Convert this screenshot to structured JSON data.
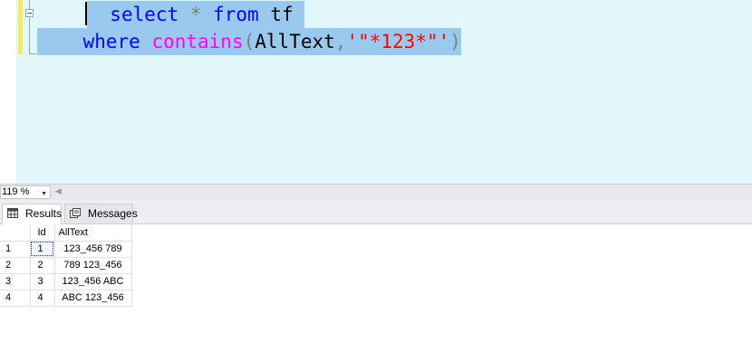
{
  "editor": {
    "line1": {
      "select": "select",
      "star": "*",
      "from": "from",
      "table": "tf"
    },
    "line2": {
      "where": "where",
      "contains": "contains",
      "open_paren": "(",
      "column": "AllText",
      "comma": ",",
      "literal": "'\"*123*\"'",
      "close_paren": ")"
    }
  },
  "zoom": {
    "value": "119 %"
  },
  "tabs": {
    "results_label": "Results",
    "messages_label": "Messages"
  },
  "grid": {
    "columns": [
      "Id",
      "AllText"
    ],
    "rows": [
      {
        "num": "1",
        "id": "1",
        "text": "123_456 789"
      },
      {
        "num": "2",
        "id": "2",
        "text": "789 123_456"
      },
      {
        "num": "3",
        "id": "3",
        "text": "123_456 ABC"
      },
      {
        "num": "4",
        "id": "4",
        "text": "ABC 123_456"
      }
    ]
  },
  "colors": {
    "editor_bg": "#e1f7fb",
    "selection": "#99c9ef",
    "keyword": "#0000ff",
    "function": "#ff00ff",
    "string": "#ff0000",
    "operator": "#808080"
  }
}
